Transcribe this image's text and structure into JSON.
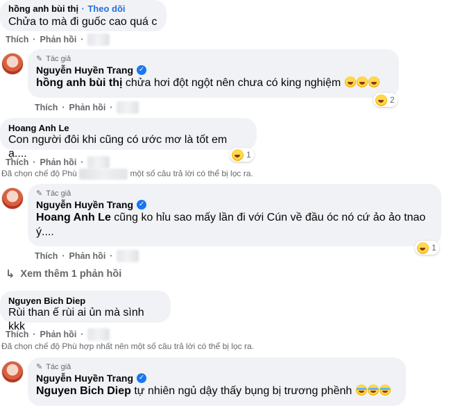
{
  "comments": [
    {
      "name": "hồng anh bùi thị",
      "follow": "Theo dõi",
      "text": "Chửa to mà đi guốc cao quá c",
      "actions": [
        "Thích",
        "Phản hồi"
      ]
    },
    {
      "author_badge": "Tác giả",
      "name": "Nguyễn Huyền Trang",
      "mention": "hồng anh bùi thị",
      "text": "chửa hơi đột ngột nên chưa có king nghiệm",
      "reaction_count": "2",
      "actions": [
        "Thích",
        "Phản hồi"
      ]
    },
    {
      "name": "Hoang Anh Le",
      "text": "Con người đôi khi cũng có ước mơ là tốt em ạ....",
      "reaction_count": "1",
      "actions": [
        "Thích",
        "Phản hồi"
      ]
    },
    {
      "author_badge": "Tác giả",
      "name": "Nguyễn Huyền Trang",
      "mention": "Hoang Anh Le",
      "text": "cũng ko hỉu sao mấy lần đi với Cún về đầu óc nó cứ ảo ảo tnao ý....",
      "reaction_count": "1",
      "actions": [
        "Thích",
        "Phản hồi"
      ]
    },
    {
      "name": "Nguyen Bich Diep",
      "text": "Rùi than ế rùi ai ủn mà sình kkk",
      "actions": [
        "Thích",
        "Phản hồi"
      ]
    },
    {
      "author_badge": "Tác giả",
      "name": "Nguyễn Huyền Trang",
      "mention": "Nguyen Bich Diep",
      "text": "tự nhiên ngủ dậy thấy bụng bị trương phềnh"
    }
  ],
  "filter_note_1a": "Đã chọn chế độ Phù",
  "filter_note_1b": "một số câu trả lời có thể bị lọc ra.",
  "filter_note_2": "Đã chọn chế độ Phù hợp nhất nên một số câu trả lời có thể bị lọc ra.",
  "see_more": "Xem thêm 1 phản hồi",
  "colors": {
    "bubble": "#f0f2f5",
    "link": "#216fdb",
    "muted": "#65676b",
    "verified": "#1877f2"
  }
}
